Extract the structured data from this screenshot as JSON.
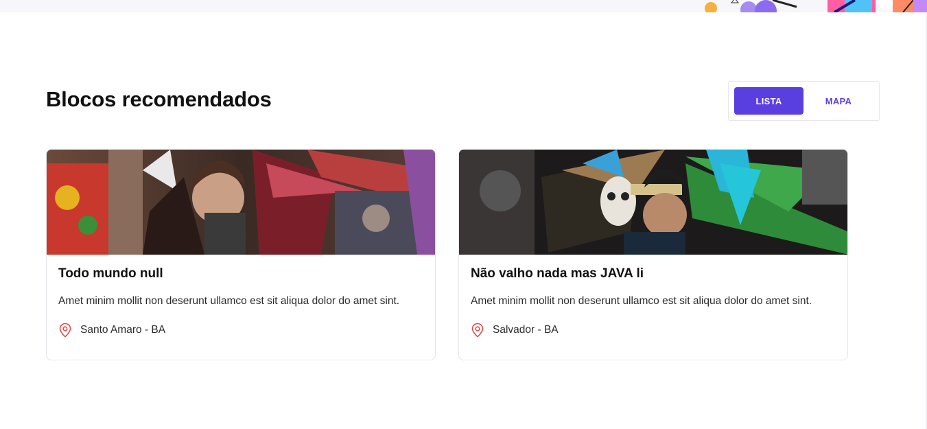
{
  "page": {
    "title": "Blocos recomendados"
  },
  "view_toggle": {
    "list_label": "LISTA",
    "map_label": "MAPA",
    "active": "LISTA",
    "accent_color": "#5a3fe0"
  },
  "cards": [
    {
      "title": "Todo mundo null",
      "description": "Amet minim mollit non deserunt ullamco est sit aliqua dolor do amet sint.",
      "location": "Santo Amaro - BA",
      "location_icon": "map-pin-icon"
    },
    {
      "title": "Não valho nada mas JAVA li",
      "description": "Amet minim mollit non deserunt ullamco est sit aliqua dolor do amet sint.",
      "location": "Salvador - BA",
      "location_icon": "map-pin-icon"
    }
  ]
}
